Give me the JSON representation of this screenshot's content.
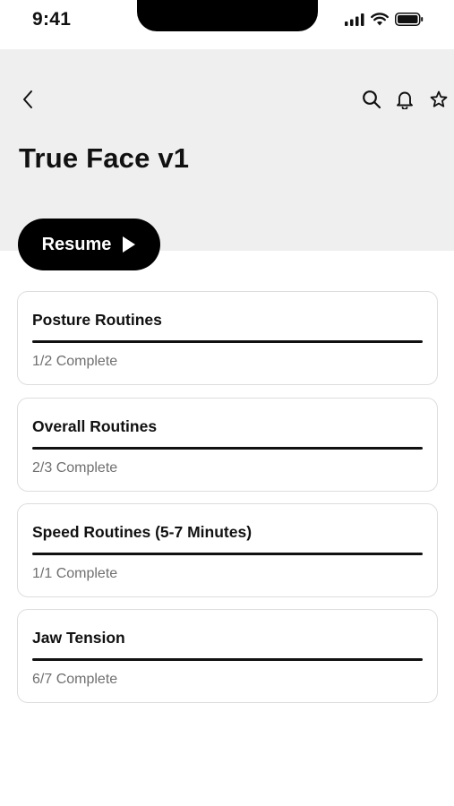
{
  "status_bar": {
    "time": "9:41"
  },
  "header": {
    "title": "True Face v1"
  },
  "resume_button": {
    "label": "Resume"
  },
  "routines": [
    {
      "title": "Posture Routines",
      "status": "1/2 Complete",
      "progress": 1.0
    },
    {
      "title": "Overall Routines",
      "status": "2/3 Complete",
      "progress": 1.0
    },
    {
      "title": "Speed Routines (5-7 Minutes)",
      "status": "1/1 Complete",
      "progress": 1.0
    },
    {
      "title": "Jaw Tension",
      "status": "6/7 Complete",
      "progress": 1.0
    }
  ],
  "icons": {
    "back": "chevron-left-icon",
    "search": "search-icon",
    "notifications": "bell-icon",
    "favorite": "star-icon",
    "play": "play-icon"
  },
  "colors": {
    "header_bg": "#efefef",
    "button_bg": "#000000",
    "progress": "#111111",
    "muted_text": "#6f6f6f"
  }
}
